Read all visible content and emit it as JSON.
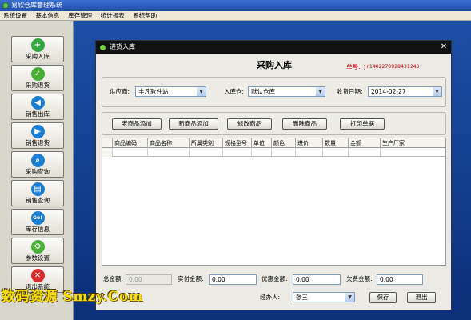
{
  "app": {
    "title": "易欣仓库管理系统"
  },
  "menu": [
    "系统设置",
    "基本信息",
    "库存管理",
    "统计报表",
    "系统帮助"
  ],
  "sidebar": [
    {
      "label": "采购入库",
      "icon": "plus-icon",
      "color": "#34a840"
    },
    {
      "label": "采购退货",
      "icon": "check-icon",
      "color": "#49b036"
    },
    {
      "label": "销售出库",
      "icon": "arrow-left-icon",
      "color": "#1a7fd4"
    },
    {
      "label": "销售退货",
      "icon": "play-icon",
      "color": "#1a7fd4"
    },
    {
      "label": "采购查询",
      "icon": "search-icon",
      "color": "#1a7fd4"
    },
    {
      "label": "销售查询",
      "icon": "document-icon",
      "color": "#1a7fd4"
    },
    {
      "label": "库存信息",
      "icon": "go-icon",
      "color": "#1a7fd4"
    },
    {
      "label": "参数设置",
      "icon": "gear-icon",
      "color": "#49b036"
    },
    {
      "label": "退出系统",
      "icon": "close-icon",
      "color": "#d92c2c"
    }
  ],
  "dialog": {
    "title": "进货入库",
    "form_title": "采购入库",
    "order_no_label": "单号:",
    "order_no": "jr1402270928431243",
    "supplier_label": "供应商:",
    "supplier_value": "丰凡软件站",
    "warehouse_label": "入库仓:",
    "warehouse_value": "默认仓库",
    "date_label": "收货日期:",
    "date_value": "2014-02-27",
    "buttons": {
      "old_product": "老商品添加",
      "new_product": "新商品添加",
      "edit_product": "修改商品",
      "delete_product": "删除商品",
      "print": "打印单据"
    },
    "columns": [
      "商品编码",
      "商品名称",
      "所属类别",
      "规格型号",
      "单位",
      "颜色",
      "进价",
      "数量",
      "金额",
      "生产厂家"
    ],
    "total_label": "总金额:",
    "total_value": "0.00",
    "paid_label": "实付金额:",
    "paid_value": "0.00",
    "discount_label": "优惠金额:",
    "discount_value": "0.00",
    "owed_label": "欠费金额:",
    "owed_value": "0.00",
    "handler_label": "经办人:",
    "handler_value": "张三",
    "save_label": "保存",
    "exit_label": "退出"
  },
  "watermark": "数码资源 Smzy.Com"
}
